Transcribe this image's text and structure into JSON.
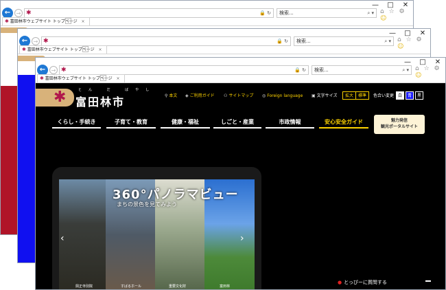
{
  "window_controls": {
    "minimize": "—",
    "maximize": "□",
    "close": "✕"
  },
  "browser": {
    "favicon": "✱",
    "address_controls": "🔒 ↻",
    "search_placeholder": "検索...",
    "search_icon": "⌕ ▾",
    "toolbar_icons": "⌂ ☆ ⚙",
    "smiley": "☺",
    "tab_title": "富田林市ウェブサイト トップページ",
    "tab_close": "×"
  },
  "site": {
    "logo_mark": "✱",
    "logo_ruby": "とん だ ばやし",
    "logo_name": "富田林市",
    "utility": {
      "text_only": "本文",
      "guide": "ご利用ガイド",
      "sitemap": "サイトマップ",
      "foreign": "Foreign language",
      "font_size": "文字サイズ",
      "enlarge": "拡大",
      "standard": "標準",
      "color_change": "色合い変更",
      "white": "白",
      "blue": "青",
      "black": "黒"
    },
    "menu": [
      "くらし・手続き",
      "子育て・教育",
      "健康・福祉",
      "しごと・産業",
      "市政情報",
      "安心安全ガイド"
    ],
    "banner_line1": "魅力発信",
    "banner_line2": "観光ポータルサイト",
    "pano": {
      "title": "360°パノラマビュー",
      "subtitle": "まちの景色を見てみよう",
      "labels": [
        "興正寺別院",
        "すばるホール",
        "重要文化財",
        "富田林"
      ],
      "arrow_left": "‹",
      "arrow_right": "›"
    },
    "jump_link": "とっぴーに質問する"
  }
}
